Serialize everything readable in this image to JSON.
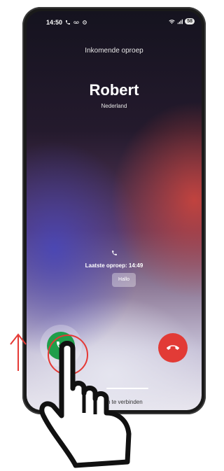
{
  "status_bar": {
    "time": "14:50",
    "battery_level": "58"
  },
  "call": {
    "label": "Inkomende oproep",
    "caller_name": "Robert",
    "caller_country": "Nederland",
    "last_call_text": "Laatste oproep: 14:49",
    "quick_reply_label": "Hallo",
    "swipe_hint": "Swipe om te verbinden"
  },
  "icons": {
    "status_left": [
      "phone-icon",
      "voicemail-icon",
      "settings-icon"
    ],
    "status_right": [
      "wifi-icon",
      "signal-icon"
    ],
    "last_call": "phone-icon",
    "answer": "phone-answer-icon",
    "decline": "phone-hangup-icon",
    "overlay": [
      "up-arrow-icon",
      "hand-pointer-icon"
    ]
  },
  "colors": {
    "answer_button": "#1f9e4a",
    "decline_button": "#e23b36",
    "annotation": "#e53935"
  }
}
